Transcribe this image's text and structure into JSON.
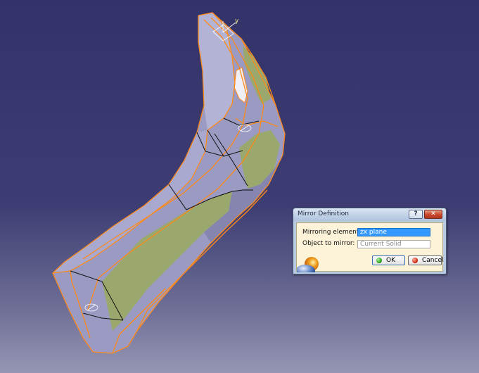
{
  "viewport": {
    "axis_label": "y",
    "background_top": "#33336a",
    "background_bottom": "#9696b4",
    "part_edge_color": "#ff8a1a",
    "part_face_color": "#9a9ac2",
    "part_green_color": "#9aa86e"
  },
  "dialog": {
    "title": "Mirror Definition",
    "help_label": "?",
    "close_label": "✕",
    "mirroring_element_label": "Mirroring element:",
    "mirroring_element_value": "zx plane",
    "object_to_mirror_label": "Object to mirror:",
    "object_to_mirror_value": "Current Solid",
    "ok_label": "OK",
    "cancel_label": "Cancel"
  }
}
